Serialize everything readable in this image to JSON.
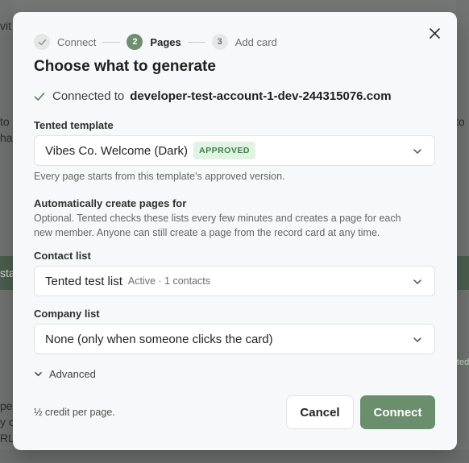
{
  "background": {
    "fragments": [
      "vit",
      "to",
      "ha",
      "sta",
      "pe",
      "y c",
      "RL",
      "s",
      "to",
      "ted"
    ]
  },
  "modal": {
    "close_icon": "close-icon",
    "steps": [
      {
        "number": "✓",
        "label": "Connect",
        "state": "done"
      },
      {
        "number": "2",
        "label": "Pages",
        "state": "active"
      },
      {
        "number": "3",
        "label": "Add card",
        "state": "todo"
      }
    ],
    "title": "Choose what to generate",
    "connected": {
      "prefix": "Connected to",
      "account": "developer-test-account-1-dev-244315076.com"
    },
    "template": {
      "label": "Tented template",
      "value": "Vibes Co. Welcome (Dark)",
      "badge": "APPROVED",
      "hint": "Every page starts from this template's approved version."
    },
    "auto_create": {
      "title": "Automatically create pages for",
      "hint_line1": "Optional. Tented checks these lists every few minutes and creates a page for each",
      "hint_line2": "new member. Anyone can still create a page from the record card at any time."
    },
    "contact_list": {
      "label": "Contact list",
      "value": "Tented test list",
      "meta": "Active · 1 contacts"
    },
    "company_list": {
      "label": "Company list",
      "value": "None (only when someone clicks the card)"
    },
    "advanced_label": "Advanced",
    "credit_note": "½ credit per page.",
    "cancel_label": "Cancel",
    "connect_label": "Connect"
  },
  "colors": {
    "accent": "#6b8e6d",
    "approved_bg": "#e1f3e3",
    "approved_text": "#3f7d46"
  }
}
